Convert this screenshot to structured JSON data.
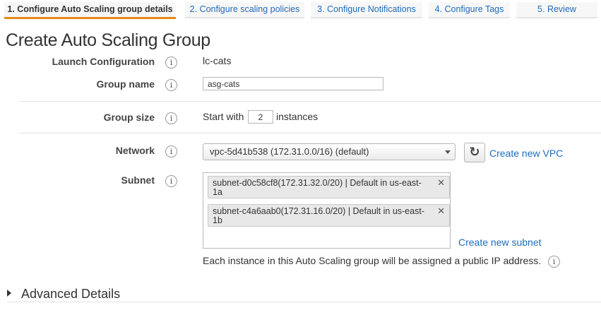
{
  "wizard": {
    "steps": [
      {
        "label": "1. Configure Auto Scaling group details",
        "active": true
      },
      {
        "label": "2. Configure scaling policies",
        "active": false
      },
      {
        "label": "3. Configure Notifications",
        "active": false
      },
      {
        "label": "4. Configure Tags",
        "active": false
      },
      {
        "label": "5. Review",
        "active": false
      }
    ]
  },
  "page": {
    "title": "Create Auto Scaling Group"
  },
  "form": {
    "launch_configuration": {
      "label": "Launch Configuration",
      "value": "lc-cats"
    },
    "group_name": {
      "label": "Group name",
      "value": "asg-cats"
    },
    "group_size": {
      "label": "Group size",
      "prefix": "Start with",
      "value": "2",
      "suffix": "instances"
    },
    "network": {
      "label": "Network",
      "selected": "vpc-5d41b538 (172.31.0.0/16) (default)",
      "create_link": "Create new VPC"
    },
    "subnet": {
      "label": "Subnet",
      "selected": [
        {
          "line1": "subnet-d0c58cf8(172.31.32.0/20) | Default in us-east-",
          "line2": "1a"
        },
        {
          "line1": "subnet-c4a6aab0(172.31.16.0/20) | Default in us-east-",
          "line2": "1b"
        }
      ],
      "create_link": "Create new subnet",
      "note": "Each instance in this Auto Scaling group will be assigned a public IP address."
    }
  },
  "advanced": {
    "label": "Advanced Details"
  },
  "icons": {
    "info": "info-icon",
    "remove": "close-icon",
    "refresh": "refresh-icon",
    "expand": "triangle-right-icon",
    "dropdown": "caret-down-icon"
  },
  "colors": {
    "accent": "#e58a17",
    "link": "#1f6cbc"
  }
}
